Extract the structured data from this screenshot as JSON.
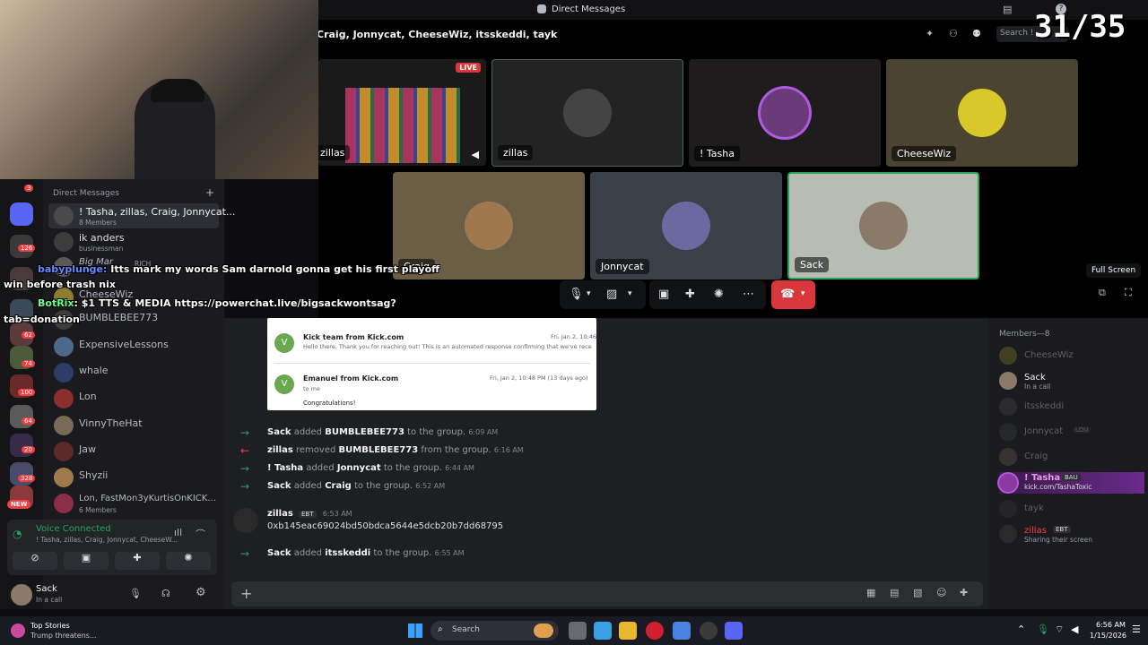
{
  "window": {
    "title": "Direct Messages",
    "search_placeholder": "Search !",
    "counter": "31/35"
  },
  "call": {
    "group_title": "Craig, Jonnycat, CheeseWiz, itsskeddi, tayk",
    "live_badge": "LIVE",
    "tiles": [
      {
        "name": "zillas",
        "bg": "#1a1a1a"
      },
      {
        "name": "zillas",
        "bg": "#232323"
      },
      {
        "name": "! Tasha",
        "bg": "#1e1c1c"
      },
      {
        "name": "CheeseWiz",
        "bg": "#4a4430"
      },
      {
        "name": "Craig",
        "bg": "#6b5e47"
      },
      {
        "name": "Jonnycat",
        "bg": "#3a4048"
      },
      {
        "name": "Sack",
        "bg": "#b8bdb4"
      }
    ],
    "fullscreen_tooltip": "Full Screen"
  },
  "sidebar": {
    "header": "Direct Messages",
    "add": "+",
    "items": [
      {
        "name": "! Tasha, zillas, Craig, Jonnycat...",
        "sub": "8 Members",
        "color": "#4a4a4a"
      },
      {
        "name": "ik anders",
        "sub": "businessman",
        "color": "#3c3c3c"
      },
      {
        "name": "Big Mar",
        "sub": "RICH",
        "color": "#5a5a5a"
      },
      {
        "name": "CheeseWiz",
        "sub": "",
        "color": "#8b7f2e"
      },
      {
        "name": "BUMBLEBEE773",
        "sub": "",
        "color": "#3d3d3d"
      },
      {
        "name": "ExpensiveLessons",
        "sub": "",
        "color": "#4e6a8a"
      },
      {
        "name": "whale",
        "sub": "",
        "color": "#2e3c6a"
      },
      {
        "name": "Lon",
        "sub": "",
        "color": "#8a2e2e"
      },
      {
        "name": "VinnyTheHat",
        "sub": "",
        "color": "#7a6a5a"
      },
      {
        "name": "Jaw",
        "sub": "",
        "color": "#5a2a2a"
      },
      {
        "name": "Shyzii",
        "sub": "",
        "color": "#a07a4a"
      },
      {
        "name": "Lon, FastMon3yKurtisOnKICK...",
        "sub": "6 Members",
        "color": "#8a2e4a"
      }
    ],
    "voice": {
      "status": "Voice Connected",
      "members": "! Tasha, zillas, Craig, Jonnycat, CheeseW..."
    },
    "user": {
      "name": "Sack",
      "status": "In a call"
    }
  },
  "rail_badges": [
    "3",
    "126",
    "24",
    "62",
    "74",
    "100",
    "64",
    "20",
    "328",
    "NEW"
  ],
  "overlay": {
    "line1_user": "babyplunge:",
    "line1_text": " Itts mark my words Sam darnold gonna get his first playoff",
    "line2": "win before trash nix",
    "line3_user": "BotRix",
    "line3_text": ": $1 TTS & MEDIA https://powerchat.live/bigsackwontsag?",
    "line4": "tab=donation"
  },
  "email": {
    "e1_from": "Kick team from Kick.com",
    "e1_date": "Fri, Jan 2, 10:46",
    "e1_body": "Hello there, Thank you for reaching out! This is an automated response confirming that we've rece",
    "e2_from": "Emanuel from Kick.com",
    "e2_date": "Fri, Jan 2, 10:48 PM (13 days ago)",
    "e2_to": "to me",
    "e2_body": "Congratulations!",
    "avatar": "V"
  },
  "messages": [
    {
      "arrow": "→",
      "actor": "Sack",
      "verb": " added ",
      "target": "BUMBLEBEE773",
      "rest": " to the group.",
      "time": "6:09 AM",
      "color": "#23a55a"
    },
    {
      "arrow": "←",
      "actor": "zillas",
      "verb": " removed ",
      "target": "BUMBLEBEE773",
      "rest": " from the group.",
      "time": "6:16 AM",
      "color": "#f23f43"
    },
    {
      "arrow": "→",
      "actor": "! Tasha",
      "verb": " added ",
      "target": "Jonnycat",
      "rest": " to the group.",
      "time": "6:44 AM",
      "color": "#23a55a"
    },
    {
      "arrow": "→",
      "actor": "Sack",
      "verb": " added ",
      "target": "Craig",
      "rest": " to the group.",
      "time": "6:52 AM",
      "color": "#23a55a"
    }
  ],
  "zillas_msg": {
    "name": "zillas",
    "badge": "EBT",
    "time": "6:53 AM",
    "text": "0xb145eac69024bd50bdca5644e5dcb20b7dd68795"
  },
  "last_msg": {
    "arrow": "→",
    "actor": "Sack",
    "verb": " added ",
    "target": "itsskeddi",
    "rest": " to the group.",
    "time": "6:55 AM"
  },
  "members": {
    "header": "Members—8",
    "list": [
      {
        "name": "CheeseWiz",
        "sub": "",
        "color": "#8b7f2e",
        "dim": true
      },
      {
        "name": "Sack",
        "sub": "In a call",
        "color": "#8a7a6a",
        "dim": false
      },
      {
        "name": "itsskeddi",
        "sub": "",
        "color": "#4a4a4a",
        "dim": true
      },
      {
        "name": "Jonnycat",
        "sub": "",
        "color": "#3a4048",
        "dim": true
      },
      {
        "name": "Craig",
        "sub": "",
        "color": "#6b5e47",
        "dim": true
      },
      {
        "name": "! Tasha",
        "sub": "kick.com/TashaToxic",
        "color": "#8a3aa0",
        "dim": false
      },
      {
        "name": "tayk",
        "sub": "",
        "color": "#3a3a3a",
        "dim": true
      },
      {
        "name": "zillas",
        "sub": "Sharing their screen",
        "color": "#2a2a2a",
        "dim": false
      }
    ],
    "jonny_badge": "LOU",
    "tasha_badge": "BAU",
    "zillas_badge": "EBT"
  },
  "taskbar": {
    "news_title": "Top Stories",
    "news_sub": "Trump threatens...",
    "search": "Search",
    "time": "6:56 AM",
    "date": "1/15/2026"
  }
}
